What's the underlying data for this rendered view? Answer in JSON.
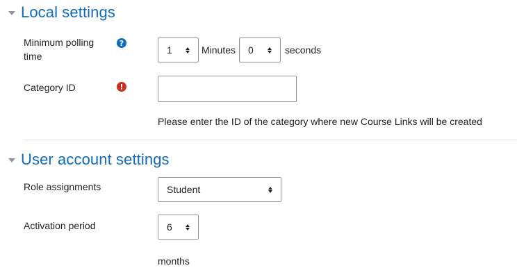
{
  "local_settings": {
    "title": "Local settings",
    "min_polling": {
      "label": "Minimum polling time",
      "minutes_value": "1",
      "minutes_unit": "Minutes",
      "seconds_value": "0",
      "seconds_unit": "seconds"
    },
    "category_id": {
      "label": "Category ID",
      "value": "",
      "description": "Please enter the ID of the category where new Course Links will be created"
    }
  },
  "user_account_settings": {
    "title": "User account settings",
    "role_assignments": {
      "label": "Role assignments",
      "selected": "Student"
    },
    "activation_period": {
      "label": "Activation period",
      "selected": "6",
      "unit": "months"
    }
  },
  "icons": {
    "help": "question-circle-icon",
    "required": "exclamation-circle-icon",
    "collapse": "caret-down-icon"
  },
  "colors": {
    "accent": "#0f6cbf",
    "required": "#ca3120",
    "border": "#8f959e",
    "divider": "#dee2e6"
  }
}
